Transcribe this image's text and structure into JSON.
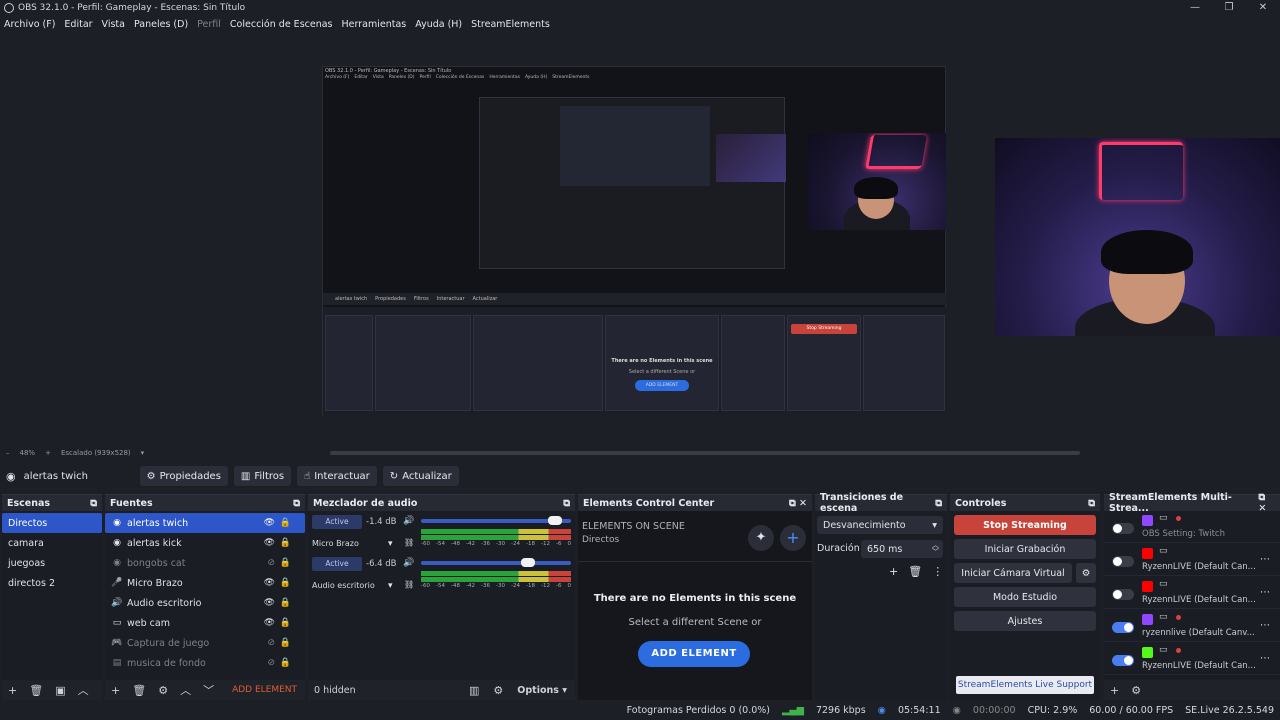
{
  "titlebar": {
    "title": "OBS 32.1.0 - Perfil: Gameplay - Escenas: Sin Título",
    "min": "—",
    "max": "❐",
    "close": "✕"
  },
  "menu": [
    {
      "label": "Archivo (F)",
      "dim": false
    },
    {
      "label": "Editar",
      "dim": false
    },
    {
      "label": "Vista",
      "dim": false
    },
    {
      "label": "Paneles (D)",
      "dim": false
    },
    {
      "label": "Perfil",
      "dim": true
    },
    {
      "label": "Colección de Escenas",
      "dim": false
    },
    {
      "label": "Herramientas",
      "dim": false
    },
    {
      "label": "Ayuda (H)",
      "dim": false
    },
    {
      "label": "StreamElements",
      "dim": false
    }
  ],
  "nested": {
    "title": "OBS 32.1.0 - Perfil: Gameplay - Escenas: Sin Título",
    "menu": [
      "Archivo (F)",
      "Editar",
      "Vista",
      "Paneles (D)",
      "Perfil",
      "Colección de Escenas",
      "Herramientas",
      "Ayuda (H)",
      "StreamElements"
    ],
    "source": "alertas twich",
    "buttons": [
      "Propiedades",
      "Filtros",
      "Interactuar",
      "Actualizar"
    ],
    "no_elements": "There are no Elements in this scene",
    "select_scene": "Select a different Scene or",
    "add_element": "ADD ELEMENT",
    "stop": "Stop Streaming",
    "status": "Fotogramas Perdidos 0 (0.0%)",
    "live": "SE.Live 26.2.5.549"
  },
  "zoom": {
    "minus": "–",
    "level": "48%",
    "plus": "+",
    "scale": "Escalado (939x528)"
  },
  "sourcebar": {
    "source_name": "alertas twich",
    "props": "Propiedades",
    "filters": "Filtros",
    "interact": "Interactuar",
    "refresh": "Actualizar"
  },
  "scenes": {
    "title": "Escenas",
    "items": [
      "Directos",
      "camara",
      "juegoas",
      "directos 2"
    ],
    "selected": 0
  },
  "sources": {
    "title": "Fuentes",
    "items": [
      {
        "label": "alertas twich",
        "icon": "◉",
        "dim": false,
        "hidden": false
      },
      {
        "label": "alertas kick",
        "icon": "◉",
        "dim": false,
        "hidden": false
      },
      {
        "label": "bongobs cat",
        "icon": "◉",
        "dim": true,
        "hidden": true
      },
      {
        "label": "Micro Brazo",
        "icon": "🎤",
        "dim": false,
        "hidden": false
      },
      {
        "label": "Audio escritorio",
        "icon": "🔊",
        "dim": false,
        "hidden": false
      },
      {
        "label": "web cam",
        "icon": "▭",
        "dim": false,
        "hidden": false
      },
      {
        "label": "Captura de juego",
        "icon": "🎮",
        "dim": true,
        "hidden": true
      },
      {
        "label": "musica de fondo",
        "icon": "▤",
        "dim": true,
        "hidden": true
      }
    ],
    "add_element": "ADD ELEMENT"
  },
  "mixer": {
    "title": "Mezclador de audio",
    "channels": [
      {
        "name": "Micro Brazo",
        "status": "Active",
        "db": "-1.4 dB",
        "level": 0.9
      },
      {
        "name": "Audio escritorio",
        "status": "Active",
        "db": "-6.4 dB",
        "level": 0.72
      }
    ],
    "ticks": [
      "-60",
      "-54",
      "-48",
      "-42",
      "-36",
      "-30",
      "-24",
      "-18",
      "-12",
      "-6",
      "0"
    ],
    "hidden": "0 hidden",
    "options": "Options"
  },
  "ecc": {
    "title": "Elements Control Center",
    "subtitle": "ELEMENTS ON SCENE",
    "scene": "Directos",
    "empty": "There are no Elements in this scene",
    "hint": "Select a different Scene or",
    "add": "ADD ELEMENT"
  },
  "transitions": {
    "title": "Transiciones de escena",
    "selected": "Desvanecimiento",
    "duration_label": "Duración",
    "duration": "650 ms"
  },
  "controls": {
    "title": "Controles",
    "stop": "Stop Streaming",
    "record": "Iniciar Grabación",
    "vcam": "Iniciar Cámara Virtual",
    "studio": "Modo Estudio",
    "settings": "Ajustes",
    "support": "StreamElements Live Support"
  },
  "multistream": {
    "title": "StreamElements Multi-Strea...",
    "items": [
      {
        "label": "OBS Setting: Twitch",
        "platform": "twitch",
        "on": false,
        "dim": true
      },
      {
        "label": "RyzennLIVE (Default Can...",
        "platform": "youtube",
        "on": false,
        "dim": false
      },
      {
        "label": "RyzennLIVE (Default Can...",
        "platform": "youtube",
        "on": false,
        "dim": false
      },
      {
        "label": "ryzennlive (Default Canv...",
        "platform": "twitch",
        "on": true,
        "dim": false
      },
      {
        "label": "RyzennLIVE (Default Can...",
        "platform": "kick",
        "on": true,
        "dim": false
      }
    ]
  },
  "status": {
    "dropped": "Fotogramas Perdidos 0 (0.0%)",
    "kbps": "7296 kbps",
    "live_time": "05:54:11",
    "rec_time": "00:00:00",
    "cpu": "CPU: 2.9%",
    "fps": "60.00 / 60.00 FPS",
    "version": "SE.Live 26.2.5.549"
  },
  "colors": {
    "accent": "#2d56c8",
    "stop": "#c8433a",
    "add": "#2b6de0",
    "twitch": "#9146ff",
    "youtube": "#ff0000",
    "kick": "#53fc18"
  }
}
